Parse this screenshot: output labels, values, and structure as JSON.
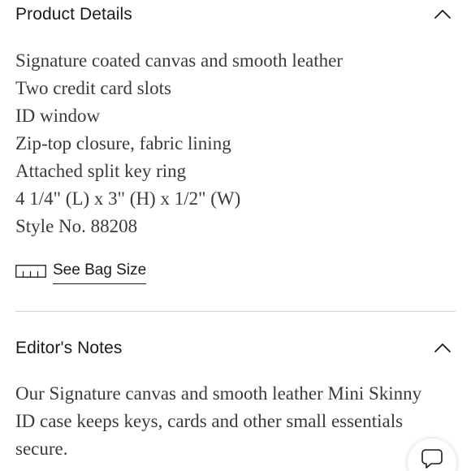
{
  "product_details": {
    "title": "Product Details",
    "items": [
      "Signature coated canvas and smooth leather",
      "Two credit card slots",
      "ID window",
      "Zip-top closure, fabric lining",
      "Attached split key ring",
      "4 1/4\" (L) x 3\" (H) x 1/2\" (W)",
      "Style No. 88208"
    ],
    "size_link_label": "See Bag Size",
    "collapse_icon": "chevron-up-icon",
    "size_icon": "ruler-icon"
  },
  "editors_notes": {
    "title": "Editor's Notes",
    "text": "Our Signature canvas and smooth leather Mini Skinny ID case keeps keys, cards and other small essentials secure.",
    "collapse_icon": "chevron-up-icon"
  },
  "chat": {
    "icon": "chat-bubble-icon"
  },
  "colors": {
    "heading_text": "#1a1a1a",
    "body_text": "#3a3a3a",
    "divider": "#d4d4d4",
    "background": "#ffffff"
  }
}
